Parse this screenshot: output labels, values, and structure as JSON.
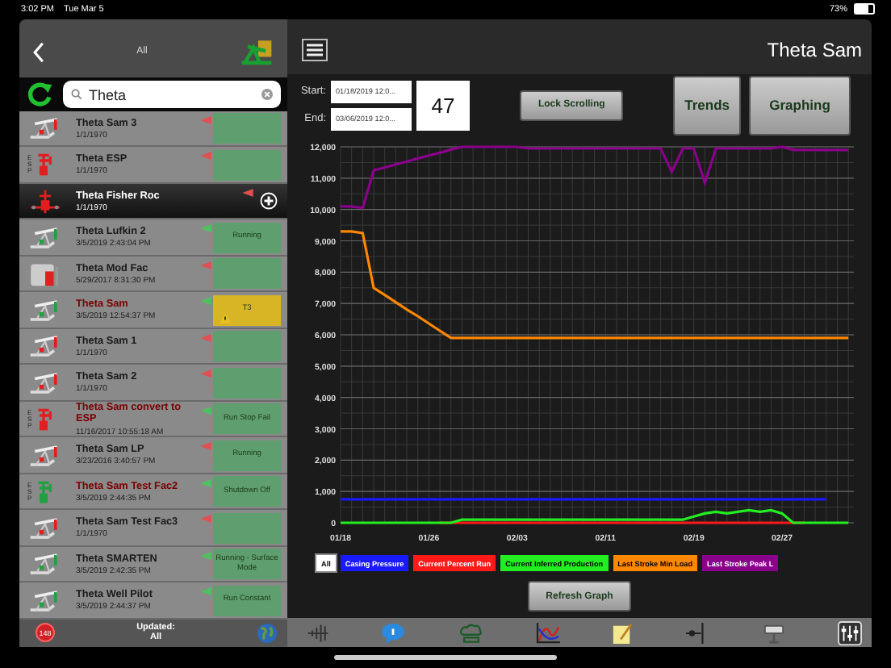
{
  "status_bar": {
    "time": "3:02 PM",
    "date": "Tue Mar 5",
    "battery": "73%"
  },
  "sidebar": {
    "title": "All",
    "search": {
      "value": "Theta"
    },
    "wells": [
      {
        "name": "Theta Sam 3",
        "date": "1/1/1970",
        "kind": "pumpjack",
        "running": false,
        "alarm": true,
        "alert": false,
        "warning": false,
        "selected": false
      },
      {
        "name": "Theta ESP",
        "date": "1/1/1970",
        "kind": "esp",
        "icon_text": "ESP",
        "running": false,
        "alarm": true,
        "alert": false,
        "warning": false,
        "selected": false
      },
      {
        "name": "Theta Fisher Roc",
        "date": "1/1/1970",
        "kind": "fisher",
        "running": false,
        "alarm": true,
        "alert": false,
        "warning": false,
        "selected": true
      },
      {
        "name": "Theta Lufkin 2",
        "date": "3/5/2019 2:43:04 PM",
        "kind": "pumpjack",
        "running": true,
        "alarm": false,
        "status": "Running",
        "alert": false,
        "warning": false,
        "selected": false
      },
      {
        "name": "Theta Mod Fac",
        "date": "5/29/2017 8:31:30 PM",
        "kind": "facility",
        "running": false,
        "alarm": true,
        "alert": false,
        "warning": false,
        "selected": false
      },
      {
        "name": "Theta Sam",
        "date": "3/5/2019 12:54:37 PM",
        "kind": "pumpjack",
        "running": true,
        "alarm": false,
        "status": "T3",
        "alert": true,
        "warning": true,
        "selected": false
      },
      {
        "name": "Theta Sam 1",
        "date": "1/1/1970",
        "kind": "pumpjack",
        "running": false,
        "alarm": true,
        "alert": false,
        "warning": false,
        "selected": false
      },
      {
        "name": "Theta Sam 2",
        "date": "1/1/1970",
        "kind": "pumpjack",
        "running": false,
        "alarm": true,
        "alert": false,
        "warning": false,
        "selected": false
      },
      {
        "name": "Theta Sam convert to ESP",
        "date": "11/16/2017 10:55:18 AM",
        "kind": "esp",
        "icon_text": "ESP",
        "running": false,
        "alarm": false,
        "status": "Run Stop Fail",
        "alert": true,
        "warning": false,
        "selected": false
      },
      {
        "name": "Theta Sam LP",
        "date": "3/23/2016 3:40:57 PM",
        "kind": "pumpjack",
        "running": false,
        "alarm": true,
        "status": "Running",
        "alert": false,
        "warning": false,
        "selected": false
      },
      {
        "name": "Theta Sam Test Fac2",
        "date": "3/5/2019 2:44:35 PM",
        "kind": "esp",
        "icon_text": "ESP",
        "running": true,
        "alarm": false,
        "status": "Shutdown Off",
        "alert": true,
        "warning": false,
        "selected": false
      },
      {
        "name": "Theta Sam Test Fac3",
        "date": "1/1/1970",
        "kind": "pumpjack",
        "running": false,
        "alarm": true,
        "alert": false,
        "warning": false,
        "selected": false
      },
      {
        "name": "Theta SMARTEN",
        "date": "3/5/2019 2:42:35 PM",
        "kind": "pumpjack",
        "running": true,
        "alarm": false,
        "status": "Running - Surface Mode",
        "alert": false,
        "warning": false,
        "selected": false
      },
      {
        "name": "Theta Well Pilot",
        "date": "3/5/2019 2:44:37 PM",
        "kind": "pumpjack",
        "running": true,
        "alarm": false,
        "status": "Run Constant",
        "alert": false,
        "warning": false,
        "selected": false
      }
    ],
    "footer": {
      "badge": "148",
      "updated_label": "Updated:",
      "updated_value": "All"
    }
  },
  "main": {
    "title": "Theta Sam",
    "range": {
      "start_label": "Start:",
      "start_value": "01/18/2019 12:0...",
      "end_label": "End:",
      "end_value": "03/06/2019 12:0...",
      "days": "47"
    },
    "buttons": [
      {
        "label": "Lock Scrolling",
        "kind": "small"
      },
      {
        "label": "Trends",
        "kind": "large"
      },
      {
        "label": "Graphing",
        "kind": "large"
      }
    ],
    "chart_data": {
      "type": "line",
      "grid": true,
      "categories": [
        "01/18",
        null,
        null,
        null,
        null,
        null,
        null,
        null,
        "01/26",
        null,
        null,
        null,
        null,
        null,
        null,
        null,
        "02/03",
        null,
        null,
        null,
        null,
        null,
        null,
        null,
        "02/11",
        null,
        null,
        null,
        null,
        null,
        null,
        null,
        "02/19",
        null,
        null,
        null,
        null,
        null,
        null,
        null,
        "02/27",
        null,
        null,
        null,
        null,
        null,
        null
      ],
      "ylim": [
        0,
        12000
      ],
      "yticks": [
        {
          "value": 0,
          "label": "0"
        },
        {
          "value": 1000,
          "label": "1,000"
        },
        {
          "value": 2000,
          "label": "2,000"
        },
        {
          "value": 3000,
          "label": "3,000"
        },
        {
          "value": 4000,
          "label": "4,000"
        },
        {
          "value": 5000,
          "label": "5,000"
        },
        {
          "value": 6000,
          "label": "6,000"
        },
        {
          "value": 7000,
          "label": "7,000"
        },
        {
          "value": 8000,
          "label": "8,000"
        },
        {
          "value": 9000,
          "label": "9,000"
        },
        {
          "value": 10000,
          "label": "10,000"
        },
        {
          "value": 11000,
          "label": "11,000"
        },
        {
          "value": 12000,
          "label": "12,000"
        }
      ],
      "series": [
        {
          "name": "Casing Pressure",
          "color": "#1a1aff",
          "values": [
            750,
            750,
            750,
            750,
            750,
            750,
            750,
            750,
            750,
            750,
            750,
            750,
            750,
            750,
            750,
            750,
            750,
            750,
            750,
            750,
            750,
            750,
            750,
            750,
            750,
            750,
            750,
            750,
            750,
            750,
            750,
            750,
            750,
            750,
            750,
            750,
            750,
            750,
            750,
            750,
            750,
            750,
            750,
            750,
            750,
            null,
            null
          ]
        },
        {
          "name": "Current Percent Run",
          "color": "#ff1a1a",
          "values": [
            null,
            null,
            null,
            null,
            null,
            null,
            null,
            null,
            null,
            0,
            0,
            0,
            0,
            0,
            0,
            0,
            0,
            0,
            0,
            0,
            0,
            0,
            0,
            0,
            0,
            0,
            0,
            0,
            0,
            0,
            0,
            0,
            0,
            0,
            0,
            0,
            0,
            0,
            0,
            0,
            0,
            0,
            0,
            null,
            null,
            null,
            null
          ]
        },
        {
          "name": "Current Inferred Production",
          "color": "#22ee22",
          "values": [
            0,
            0,
            0,
            0,
            0,
            0,
            0,
            0,
            0,
            0,
            0,
            100,
            100,
            100,
            100,
            100,
            100,
            100,
            100,
            100,
            100,
            100,
            100,
            100,
            100,
            100,
            100,
            100,
            100,
            100,
            100,
            100,
            200,
            300,
            350,
            300,
            350,
            400,
            350,
            400,
            300,
            0,
            0,
            0,
            0,
            0,
            0
          ]
        },
        {
          "name": "Last Stroke Min Load",
          "color": "#ff8800",
          "values": [
            9300,
            9300,
            9250,
            7500,
            7270,
            7040,
            6810,
            6590,
            6360,
            6130,
            5900,
            5900,
            5900,
            5900,
            5900,
            5900,
            5900,
            5900,
            5900,
            5900,
            5900,
            5900,
            5900,
            5900,
            5900,
            5900,
            5900,
            5900,
            5900,
            5900,
            5900,
            5900,
            5900,
            5900,
            5900,
            5900,
            5900,
            5900,
            5900,
            5900,
            5900,
            5900,
            5900,
            5900,
            5900,
            5900,
            5900
          ]
        },
        {
          "name": "Last Stroke Peak L",
          "color": "#8b008b",
          "values": [
            10100,
            10100,
            10050,
            11250,
            11340,
            11440,
            11530,
            11630,
            11720,
            11810,
            11910,
            12000,
            12000,
            12000,
            12000,
            12000,
            12000,
            11950,
            11950,
            11950,
            11950,
            11950,
            11950,
            11950,
            11950,
            11950,
            11950,
            11950,
            11950,
            11950,
            11200,
            11950,
            11950,
            10850,
            11950,
            11950,
            11950,
            11950,
            11950,
            11950,
            12000,
            11900,
            11900,
            11900,
            11900,
            11900,
            11900
          ]
        }
      ]
    },
    "legend": {
      "all_label": "All",
      "all_selected": true
    },
    "refresh": "Refresh Graph"
  }
}
